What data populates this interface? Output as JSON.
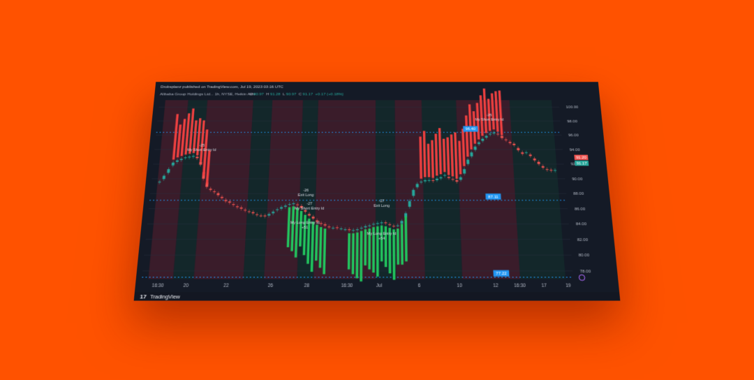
{
  "header": {
    "published": "Drobsplanz published on TradingView.com, Jul 19, 2023 03:16 UTC",
    "symbol": "Alibaba Group Holdings Ltd... 1h, NYSE, Heikin Ashi",
    "o_label": "O",
    "o_value": "90.97",
    "h_label": "H",
    "h_value": "91.28",
    "l_label": "L",
    "l_value": "90.97",
    "c_label": "C",
    "c_value": "91.17",
    "change": "+0.17 (+0.18%)"
  },
  "brand": {
    "logo_text": "17",
    "name": "TradingView"
  },
  "price_labels": {
    "current_red": "91.20",
    "current_green": "91.17",
    "tag_top": "96.40",
    "tag_mid": "87.11",
    "tag_bottom": "77.22"
  },
  "colors": {
    "up": "#26a69a",
    "down": "#ef5350",
    "strong_up": "#22c55e",
    "strong_down": "#ef4040",
    "level_line": "#2196f3",
    "bg": "#141a26",
    "shade_red": "#5a1f2e",
    "shade_green": "#12332d",
    "background": "#ff5200"
  },
  "chart_data": {
    "type": "candlestick",
    "style": "Heikin Ashi",
    "ylim": [
      77,
      101
    ],
    "y_ticks": [
      "100.00",
      "98.00",
      "96.00",
      "94.00",
      "92.00",
      "90.00",
      "88.00",
      "86.00",
      "84.00",
      "82.00",
      "80.00",
      "78.00"
    ],
    "x_ticks": [
      "16:30",
      "20",
      "22",
      "26",
      "28",
      "16:30",
      "Jul",
      "6",
      "10",
      "12",
      "16:30",
      "17",
      "19"
    ],
    "horizontal_levels": [
      96.4,
      87.11,
      77.22
    ],
    "closes": [
      89.6,
      90.4,
      91.3,
      92.2,
      92.5,
      92.7,
      92.9,
      93.0,
      93.1,
      92.8,
      91.9,
      90.0,
      88.9,
      88.5,
      88.2,
      87.8,
      87.4,
      87.0,
      86.8,
      86.5,
      86.2,
      86.0,
      85.8,
      85.6,
      85.4,
      85.2,
      85.1,
      85.0,
      85.3,
      85.6,
      85.9,
      86.2,
      86.4,
      86.6,
      86.7,
      86.5,
      86.1,
      85.6,
      85.1,
      84.7,
      84.3,
      84.0,
      83.8,
      83.6,
      83.5,
      83.5,
      83.4,
      83.3,
      83.2,
      83.2,
      83.3,
      83.5,
      83.7,
      83.8,
      84.0,
      84.1,
      84.2,
      84.1,
      83.9,
      83.7,
      83.8,
      84.4,
      85.4,
      87.0,
      88.5,
      89.3,
      89.6,
      89.8,
      89.8,
      89.7,
      90.0,
      90.2,
      90.5,
      90.1,
      89.9,
      89.6,
      90.2,
      91.3,
      92.6,
      93.6,
      94.4,
      95.0,
      95.5,
      95.9,
      96.2,
      96.4,
      96.1,
      95.6,
      95.3,
      94.9,
      94.6,
      93.9,
      93.4,
      93.6,
      93.1,
      92.5,
      92.0,
      91.5,
      91.2,
      91.1,
      91.17
    ],
    "strong_bull_bars": [
      33,
      34,
      35,
      36,
      37,
      38,
      39,
      40,
      41,
      42,
      48,
      49,
      50,
      51,
      52,
      53,
      54,
      55,
      56,
      57,
      58,
      59,
      60,
      61,
      62
    ],
    "strong_bear_bars": [
      3,
      4,
      5,
      6,
      7,
      8,
      9,
      10,
      11,
      12,
      66,
      67,
      68,
      69,
      70,
      71,
      72,
      73,
      74,
      75,
      76,
      77,
      78,
      79,
      80,
      81,
      82,
      83,
      84,
      85,
      86,
      87
    ],
    "annotations": [
      {
        "bar": 10,
        "lines": [
          "-25",
          "My Short Entry Id"
        ]
      },
      {
        "bar": 37,
        "lines": [
          "-26",
          "Exit Long"
        ]
      },
      {
        "bar": 38,
        "lines": [
          "-27",
          "My Short Entry Id"
        ]
      },
      {
        "bar": 37,
        "lines": [
          "My Long Entry Id",
          "+51"
        ]
      },
      {
        "bar": 56,
        "lines": [
          "-27",
          "Exit Long"
        ]
      },
      {
        "bar": 56,
        "lines": [
          "My Long Entry Id",
          "+54"
        ]
      },
      {
        "bar": 84,
        "lines": [
          "-25",
          "My Short Entry Id"
        ]
      }
    ]
  }
}
